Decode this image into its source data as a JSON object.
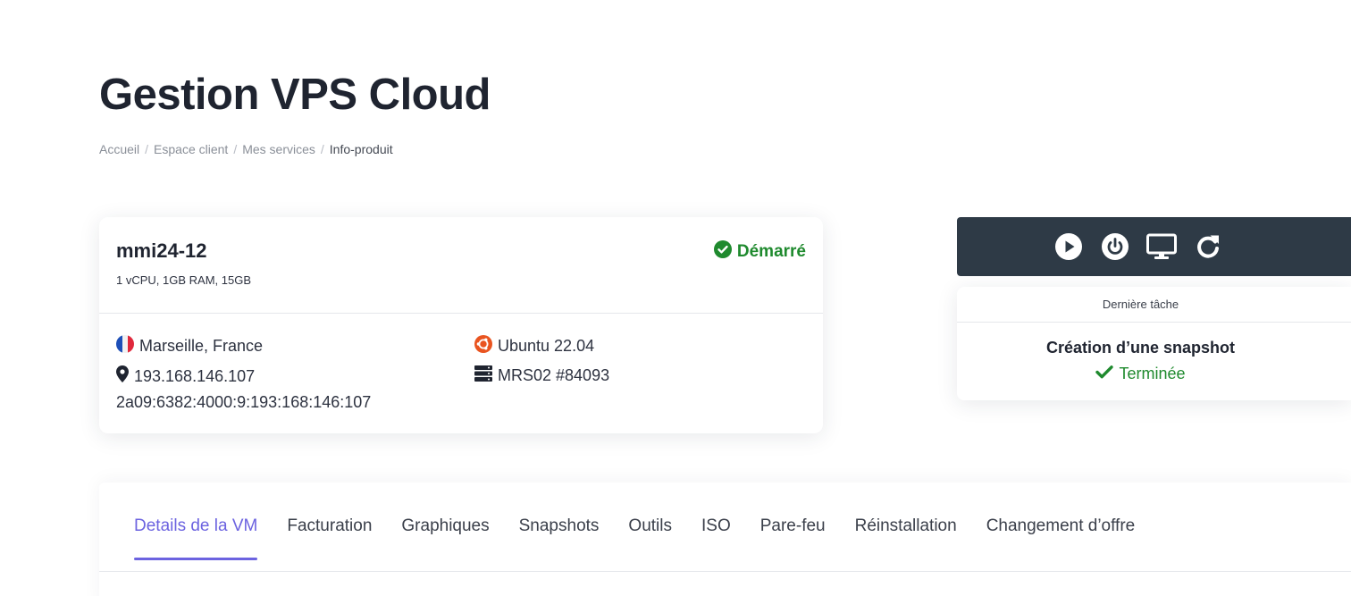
{
  "page": {
    "title": "Gestion VPS Cloud",
    "breadcrumb": [
      "Accueil",
      "Espace client",
      "Mes services",
      "Info-produit"
    ]
  },
  "vm": {
    "name": "mmi24-12",
    "specs": "1 vCPU, 1GB RAM, 15GB",
    "status": "Démarré",
    "location": "Marseille, France",
    "ipv4": "193.168.146.107",
    "ipv6": "2a09:6382:4000:9:193:168:146:107",
    "os": "Ubuntu 22.04",
    "server": "MRS02 #84093"
  },
  "actions": [
    {
      "name": "start-button",
      "icon": "play-circle-icon"
    },
    {
      "name": "power-button",
      "icon": "power-icon"
    },
    {
      "name": "console-button",
      "icon": "monitor-icon"
    },
    {
      "name": "restart-button",
      "icon": "redo-icon"
    }
  ],
  "task": {
    "header": "Dernière tâche",
    "name": "Création d’une snapshot",
    "state": "Terminée"
  },
  "tabs": [
    {
      "label": "Details de la VM",
      "active": true
    },
    {
      "label": "Facturation"
    },
    {
      "label": "Graphiques"
    },
    {
      "label": "Snapshots"
    },
    {
      "label": "Outils"
    },
    {
      "label": "ISO"
    },
    {
      "label": "Pare-feu"
    },
    {
      "label": "Réinstallation"
    },
    {
      "label": "Changement d’offre"
    }
  ],
  "colors": {
    "accent": "#6c63e0",
    "success": "#1f8a2e",
    "action_bar": "#2e3a46",
    "ubuntu": "#e95420"
  }
}
